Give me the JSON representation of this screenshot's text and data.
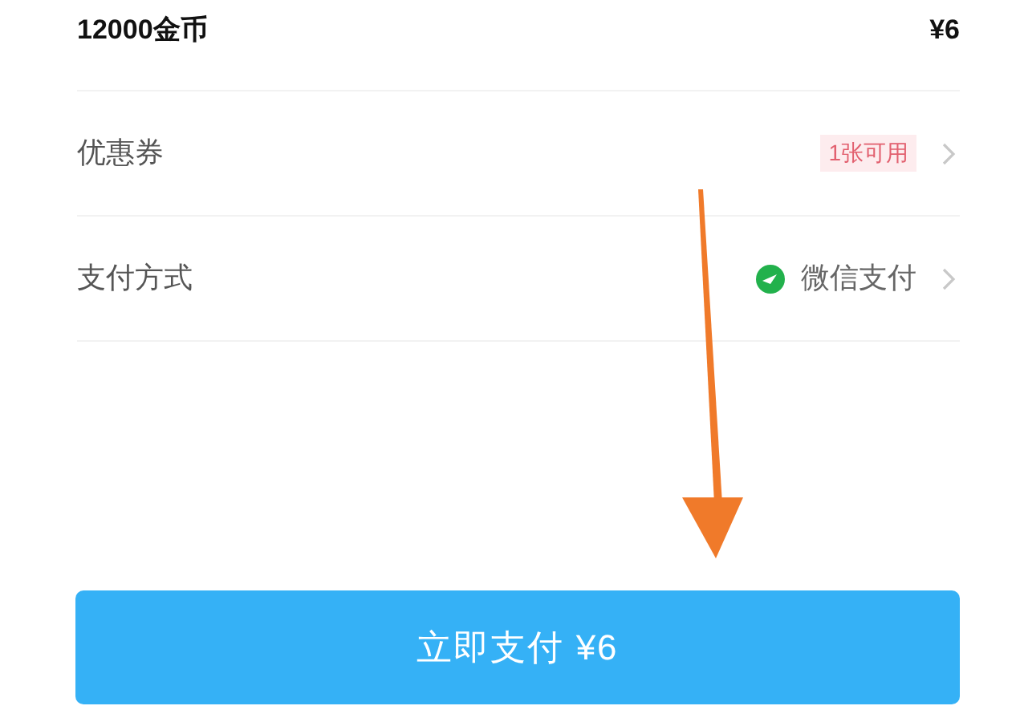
{
  "order_item": {
    "name": "12000金币",
    "price": "¥6"
  },
  "rows": [
    {
      "kind": "coupon",
      "label": "优惠券",
      "value": "1张可用"
    },
    {
      "kind": "payment",
      "label": "支付方式",
      "value": "微信支付"
    }
  ],
  "pay_button": {
    "label": "立即支付 ¥6"
  }
}
